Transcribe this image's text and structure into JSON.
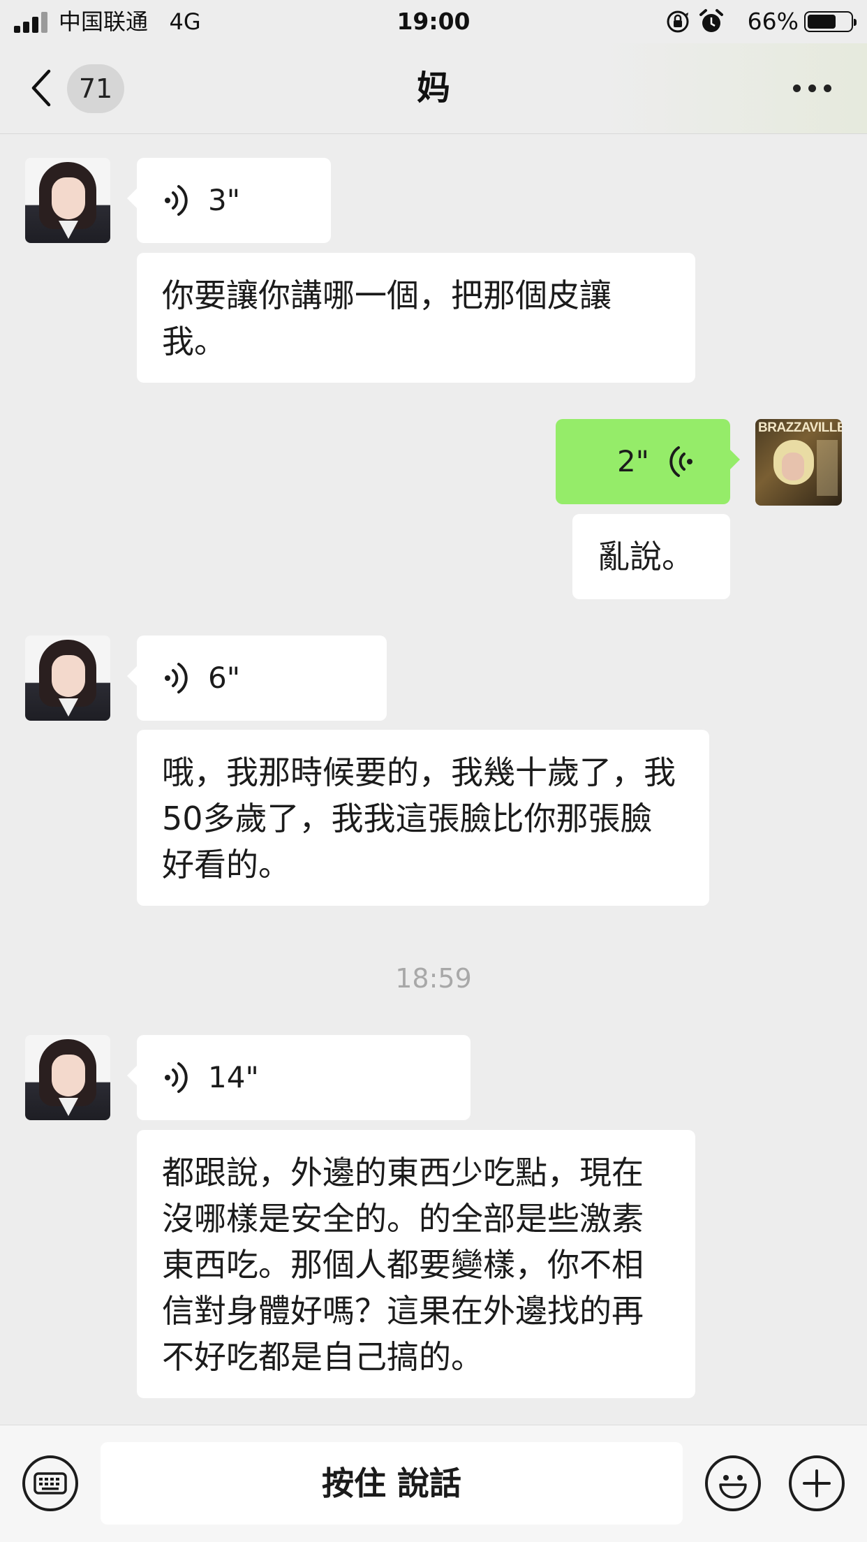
{
  "status_bar": {
    "carrier": "中国联通",
    "network": "4G",
    "time": "19:00",
    "battery": "66%"
  },
  "nav": {
    "unread_count": "71",
    "title": "妈"
  },
  "messages": [
    {
      "sender": "mom",
      "type": "voice",
      "duration": "3\""
    },
    {
      "sender": "mom",
      "type": "text",
      "text": "你要讓你講哪一個，把那個皮讓我。"
    },
    {
      "sender": "me",
      "type": "voice",
      "duration": "2\""
    },
    {
      "sender": "me",
      "type": "text",
      "text": "亂說。"
    },
    {
      "sender": "mom",
      "type": "voice",
      "duration": "6\""
    },
    {
      "sender": "mom",
      "type": "text",
      "text": "哦，我那時候要的，我幾十歲了，我50多歲了，我我這張臉比你那張臉好看的。"
    },
    {
      "sender": "mom",
      "type": "voice",
      "duration": "14\""
    },
    {
      "sender": "mom",
      "type": "text",
      "text": "都跟說，外邊的東西少吃點，現在沒哪樣是安全的。的全部是些激素東西吃。那個人都要變樣，你不相信對身體好嗎？這果在外邊找的再不好吃都是自己搞的。"
    }
  ],
  "time_divider": "18:59",
  "my_avatar_text": "BRAZZAVILLE",
  "input_bar": {
    "hold_to_talk": "按住 說話"
  },
  "colors": {
    "background": "#ededed",
    "my_bubble": "#95ec69",
    "their_bubble": "#ffffff"
  },
  "icons": [
    "signal-icon",
    "rotation-lock-icon",
    "alarm-icon",
    "battery-icon",
    "back-icon",
    "more-icon",
    "voice-wave-icon",
    "keyboard-icon",
    "emoji-icon",
    "plus-icon"
  ]
}
